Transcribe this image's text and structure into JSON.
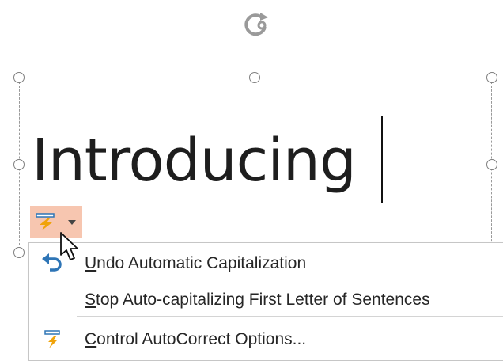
{
  "slide": {
    "title_text": "Introducing"
  },
  "autocorrect_menu": {
    "items": [
      {
        "accel": "U",
        "rest": "ndo Automatic Capitalization",
        "icon": "undo-icon"
      },
      {
        "accel": "S",
        "rest": "top Auto-capitalizing First Letter of Sentences",
        "icon": ""
      },
      {
        "accel": "C",
        "rest": "ontrol AutoCorrect Options...",
        "icon": "autocorrect-options-icon"
      }
    ]
  },
  "colors": {
    "autocorrect_button_bg": "#f7c6b0",
    "undo_icon": "#2e75b6",
    "bolt_icon": "#f0a30a"
  }
}
